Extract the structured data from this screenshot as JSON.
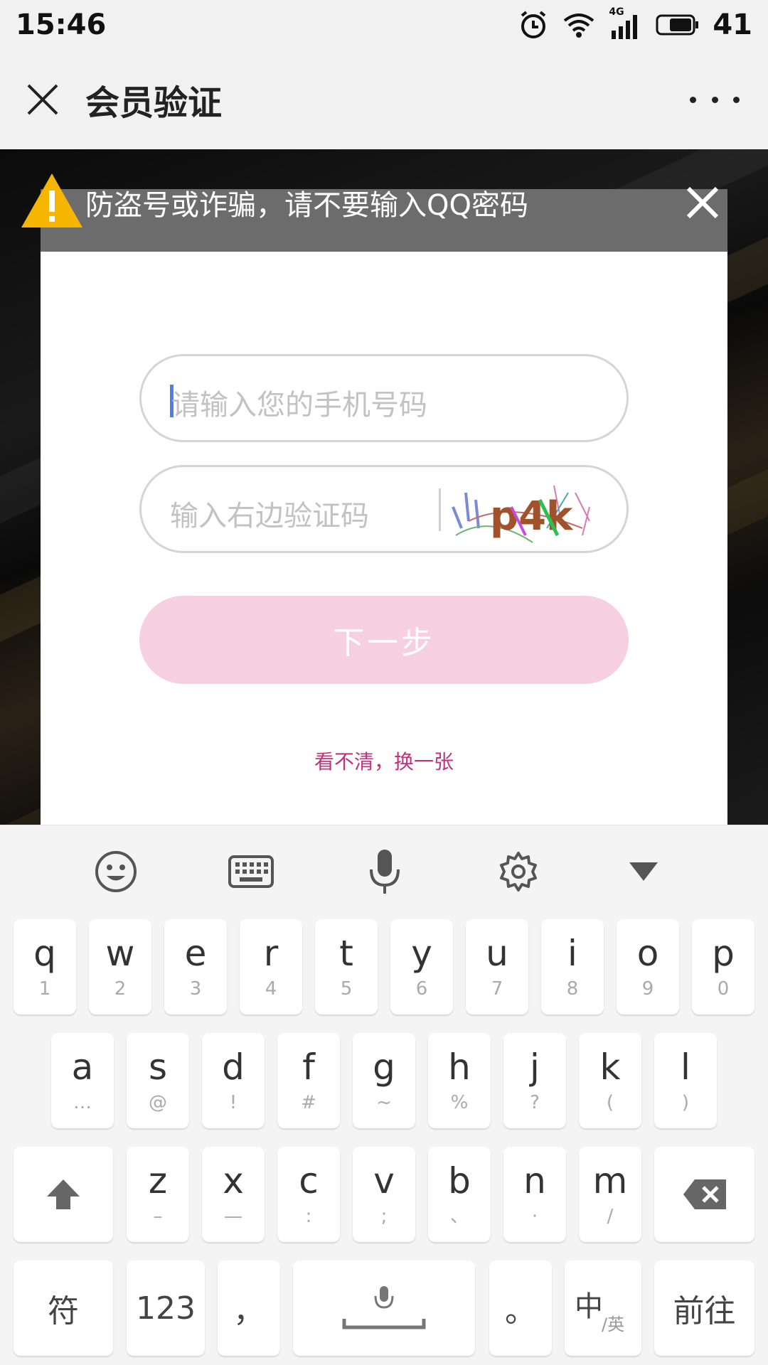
{
  "status_bar": {
    "time": "15:46",
    "battery": "41",
    "network": "4G"
  },
  "title_bar": {
    "title": "会员验证"
  },
  "modal": {
    "warning": "防盗号或诈骗，请不要输入QQ密码",
    "phone_placeholder": "请输入您的手机号码",
    "captcha_placeholder": "输入右边验证码",
    "captcha_text": "p4k",
    "next_label": "下一步",
    "refresh_link": "看不清，换一张"
  },
  "keyboard": {
    "row1": [
      {
        "main": "q",
        "sub": "1"
      },
      {
        "main": "w",
        "sub": "2"
      },
      {
        "main": "e",
        "sub": "3"
      },
      {
        "main": "r",
        "sub": "4"
      },
      {
        "main": "t",
        "sub": "5"
      },
      {
        "main": "y",
        "sub": "6"
      },
      {
        "main": "u",
        "sub": "7"
      },
      {
        "main": "i",
        "sub": "8"
      },
      {
        "main": "o",
        "sub": "9"
      },
      {
        "main": "p",
        "sub": "0"
      }
    ],
    "row2": [
      {
        "main": "a",
        "sub": "…"
      },
      {
        "main": "s",
        "sub": "@"
      },
      {
        "main": "d",
        "sub": "!"
      },
      {
        "main": "f",
        "sub": "#"
      },
      {
        "main": "g",
        "sub": "~"
      },
      {
        "main": "h",
        "sub": "%"
      },
      {
        "main": "j",
        "sub": "?"
      },
      {
        "main": "k",
        "sub": "("
      },
      {
        "main": "l",
        "sub": ")"
      }
    ],
    "row3": [
      {
        "main": "z",
        "sub": "–"
      },
      {
        "main": "x",
        "sub": "—"
      },
      {
        "main": "c",
        "sub": ":"
      },
      {
        "main": "v",
        "sub": ";"
      },
      {
        "main": "b",
        "sub": "、"
      },
      {
        "main": "n",
        "sub": "·"
      },
      {
        "main": "m",
        "sub": "/"
      }
    ],
    "symbol_key": "符",
    "num_key": "123",
    "comma_key": "，",
    "period_key": "。",
    "lang_main": "中",
    "lang_sub": "/英",
    "go_key": "前往"
  }
}
